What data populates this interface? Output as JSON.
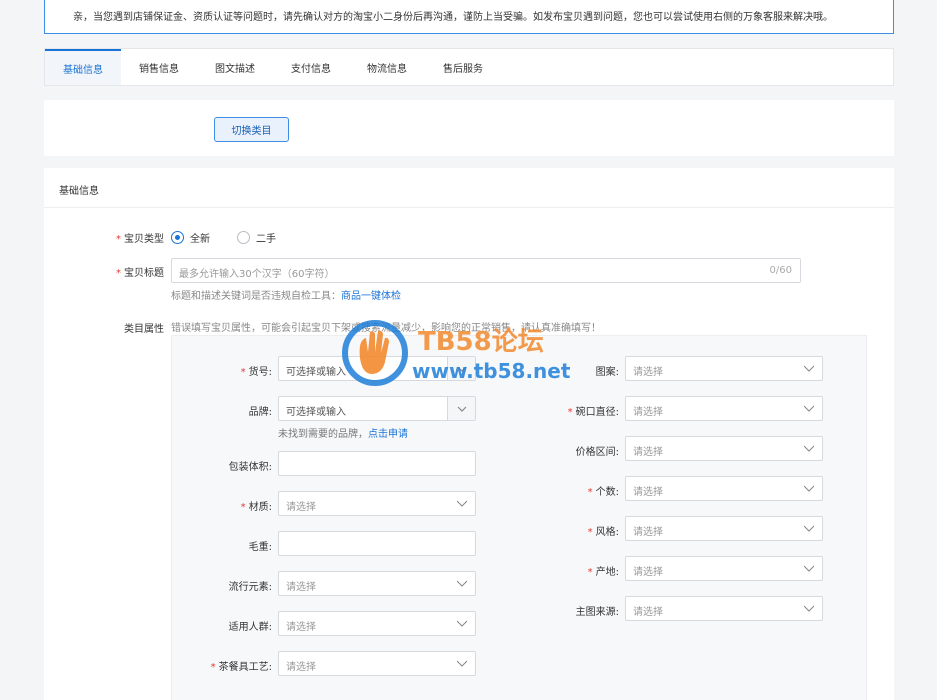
{
  "notice": {
    "text": "亲，当您遇到店铺保证金、资质认证等问题时，请先确认对方的淘宝小二身份后再沟通，谨防上当受骗。如发布宝贝遇到问题，您也可以尝试使用右侧的万象客服来解决哦。"
  },
  "tabs": [
    {
      "label": "基础信息",
      "active": true
    },
    {
      "label": "销售信息"
    },
    {
      "label": "图文描述"
    },
    {
      "label": "支付信息"
    },
    {
      "label": "物流信息"
    },
    {
      "label": "售后服务"
    }
  ],
  "category": {
    "switch_label": "切换类目"
  },
  "panel": {
    "title": "基础信息"
  },
  "item_type": {
    "label": "宝贝类型",
    "options": [
      {
        "label": "全新",
        "checked": true
      },
      {
        "label": "二手",
        "checked": false
      }
    ]
  },
  "item_title": {
    "label": "宝贝标题",
    "placeholder": "最多允许输入30个汉字（60字符）",
    "count": "0/60",
    "hint": "标题和描述关键词是否违规自检工具：",
    "hint_link": "商品一键体检"
  },
  "attributes": {
    "label": "类目属性",
    "hint": "错误填写宝贝属性，可能会引起宝贝下架或搜索流量减少，影响您的正常销售，请认真准确填写！",
    "left": [
      {
        "label": "货号",
        "required": true,
        "type": "combo",
        "value": "可选择或输入"
      },
      {
        "label": "品牌",
        "required": false,
        "type": "combo",
        "value": "可选择或输入",
        "note": "未找到需要的品牌，",
        "note_link": "点击申请"
      },
      {
        "label": "包装体积",
        "required": false,
        "type": "text"
      },
      {
        "label": "材质",
        "required": true,
        "type": "select",
        "value": "请选择"
      },
      {
        "label": "毛重",
        "required": false,
        "type": "text"
      },
      {
        "label": "流行元素",
        "required": false,
        "type": "select",
        "value": "请选择"
      },
      {
        "label": "适用人群",
        "required": false,
        "type": "select",
        "value": "请选择"
      },
      {
        "label": "茶餐具工艺",
        "required": true,
        "type": "select",
        "value": "请选择"
      }
    ],
    "right": [
      {
        "label": "图案",
        "required": false,
        "value": "请选择"
      },
      {
        "label": "碗口直径",
        "required": true,
        "value": "请选择"
      },
      {
        "label": "价格区间",
        "required": false,
        "value": "请选择"
      },
      {
        "label": "个数",
        "required": true,
        "value": "请选择"
      },
      {
        "label": "风格",
        "required": true,
        "value": "请选择"
      },
      {
        "label": "产地",
        "required": true,
        "value": "请选择"
      },
      {
        "label": "主图来源",
        "required": false,
        "value": "请选择"
      }
    ]
  },
  "watermark": {
    "brand": "TB58论坛",
    "url": "www.tb58.net"
  },
  "colors": {
    "accent": "#1a73d6",
    "required": "#e53935",
    "watermark_orange": "#f28a2e",
    "watermark_blue": "#1f7fd8"
  }
}
